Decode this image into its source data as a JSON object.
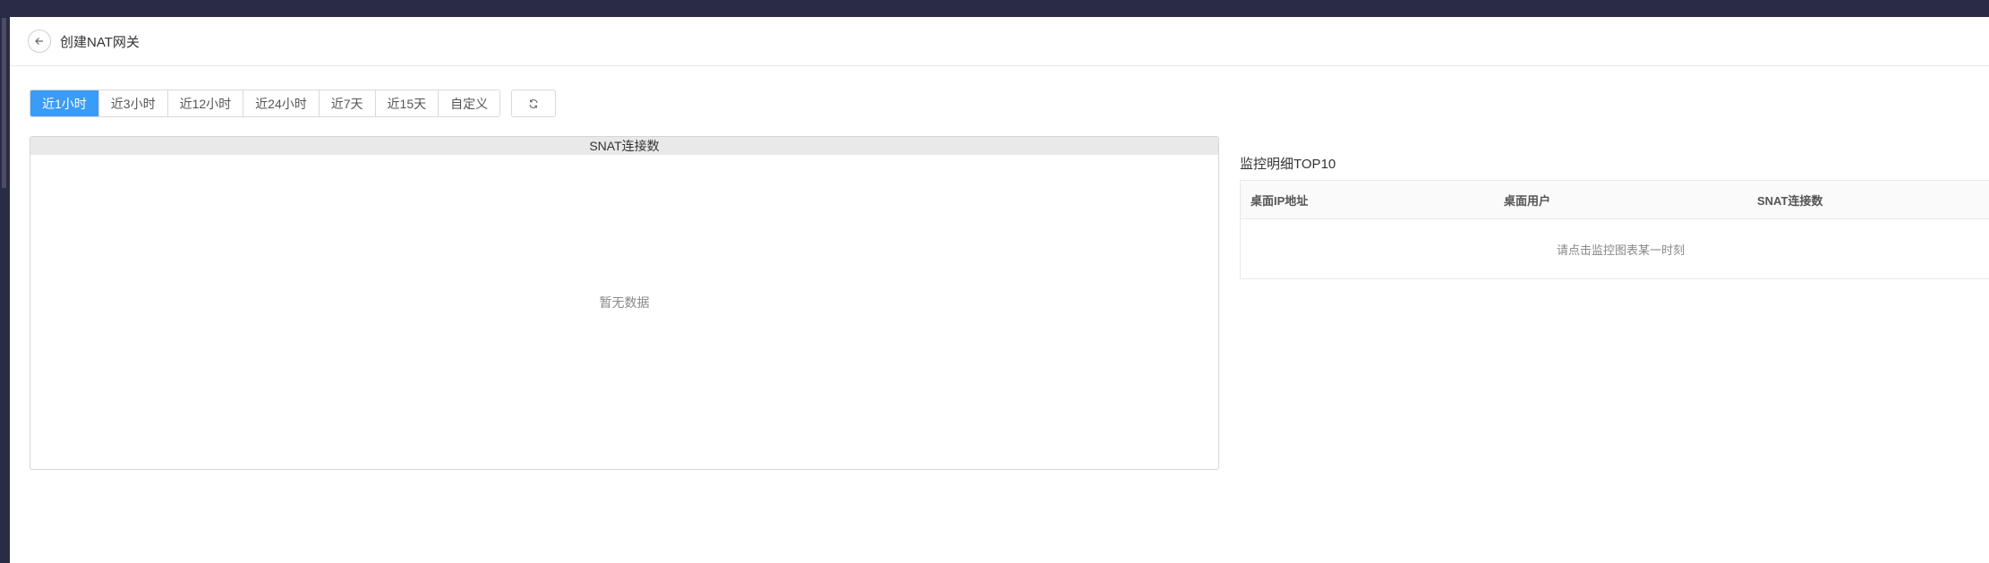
{
  "header": {
    "title": "创建NAT网关"
  },
  "toolbar": {
    "ranges": [
      {
        "label": "近1小时",
        "active": true
      },
      {
        "label": "近3小时",
        "active": false
      },
      {
        "label": "近12小时",
        "active": false
      },
      {
        "label": "近24小时",
        "active": false
      },
      {
        "label": "近7天",
        "active": false
      },
      {
        "label": "近15天",
        "active": false
      },
      {
        "label": "自定义",
        "active": false
      }
    ]
  },
  "chart": {
    "title": "SNAT连接数",
    "empty_text": "暂无数据"
  },
  "detail": {
    "title": "监控明细TOP10",
    "columns": [
      "桌面IP地址",
      "桌面用户",
      "SNAT连接数"
    ],
    "empty_text": "请点击监控图表某一时刻"
  },
  "colors": {
    "accent": "#3b9cf7",
    "outer_bg": "#2a2b45"
  }
}
